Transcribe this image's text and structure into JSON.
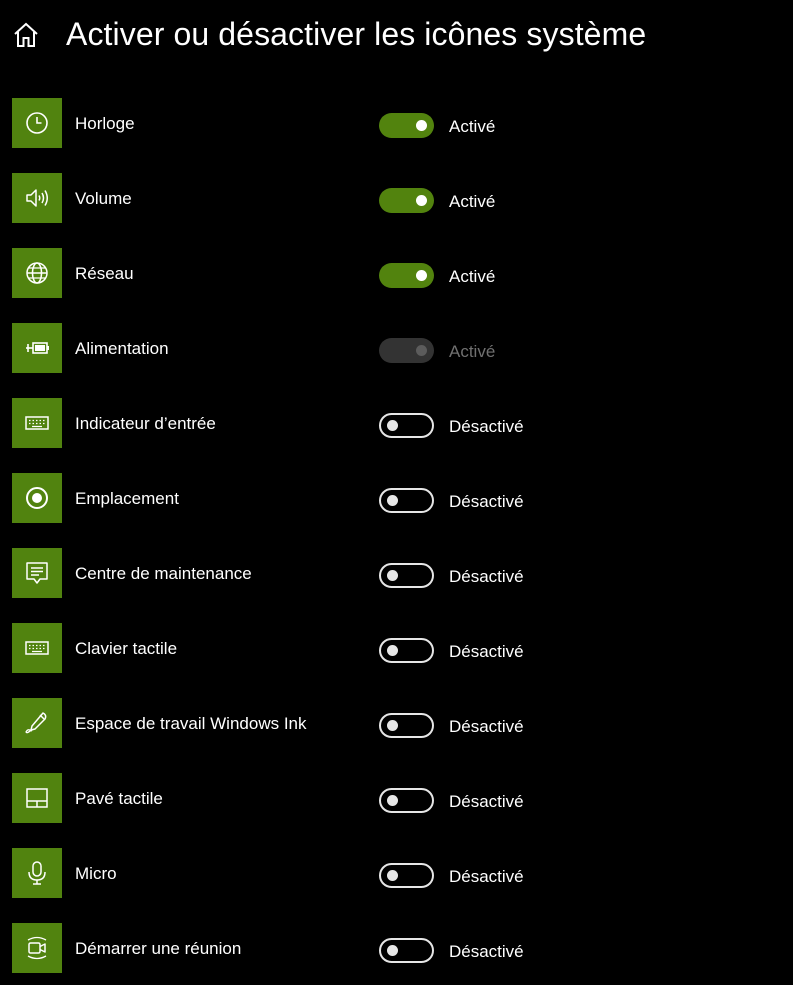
{
  "header": {
    "home_icon": "home-icon",
    "title": "Activer ou désactiver les icônes système"
  },
  "colors": {
    "background": "#000000",
    "accent": "#51830f",
    "text": "#ffffff",
    "disabled_text": "#707070"
  },
  "items": [
    {
      "label": "Horloge",
      "icon": "clock-icon",
      "state": "Activé",
      "on": true,
      "enabled": true
    },
    {
      "label": "Volume",
      "icon": "volume-icon",
      "state": "Activé",
      "on": true,
      "enabled": true
    },
    {
      "label": "Réseau",
      "icon": "globe-icon",
      "state": "Activé",
      "on": true,
      "enabled": true
    },
    {
      "label": "Alimentation",
      "icon": "battery-plug-icon",
      "state": "Activé",
      "on": true,
      "enabled": false
    },
    {
      "label": "Indicateur d’entrée",
      "icon": "keyboard-icon",
      "state": "Désactivé",
      "on": false,
      "enabled": true
    },
    {
      "label": "Emplacement",
      "icon": "location-icon",
      "state": "Désactivé",
      "on": false,
      "enabled": true
    },
    {
      "label": "Centre de maintenance",
      "icon": "action-center-icon",
      "state": "Désactivé",
      "on": false,
      "enabled": true
    },
    {
      "label": "Clavier tactile",
      "icon": "keyboard-icon",
      "state": "Désactivé",
      "on": false,
      "enabled": true
    },
    {
      "label": "Espace de travail Windows Ink",
      "icon": "pen-icon",
      "state": "Désactivé",
      "on": false,
      "enabled": true
    },
    {
      "label": "Pavé tactile",
      "icon": "touchpad-icon",
      "state": "Désactivé",
      "on": false,
      "enabled": true
    },
    {
      "label": "Micro",
      "icon": "microphone-icon",
      "state": "Désactivé",
      "on": false,
      "enabled": true
    },
    {
      "label": "Démarrer une réunion",
      "icon": "meet-now-icon",
      "state": "Désactivé",
      "on": false,
      "enabled": true
    }
  ]
}
